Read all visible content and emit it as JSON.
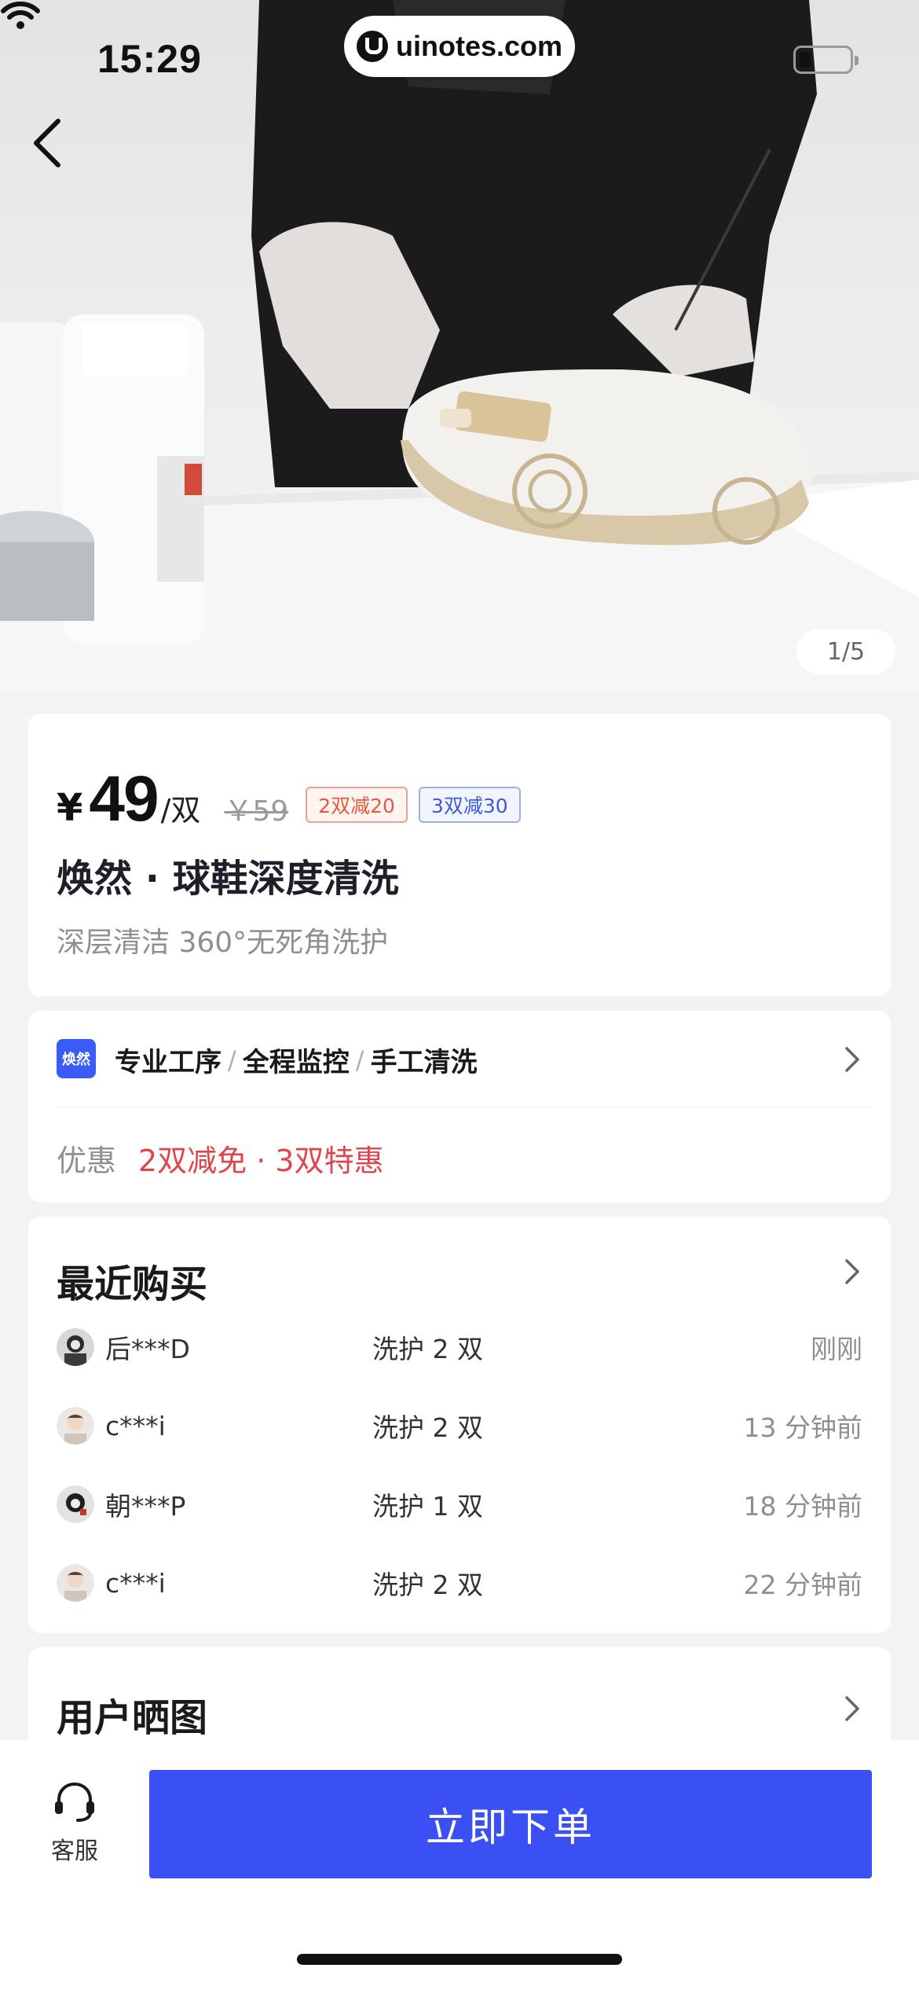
{
  "status_bar": {
    "time": "15:29",
    "url": "uinotes.com"
  },
  "hero": {
    "page_indicator": "1/5"
  },
  "product": {
    "currency": "¥",
    "price": "49",
    "unit": "/双",
    "original_price": "￥59",
    "tags": [
      "2双减20",
      "3双减30"
    ],
    "title": "焕然 · 球鞋深度清洗",
    "subtitle": "深层清洁 360°无死角洗护"
  },
  "features": {
    "badge": "焕然",
    "items": [
      "专业工序",
      "全程监控",
      "手工清洗"
    ],
    "separator": "/",
    "promo_label": "优惠",
    "promo_value": "2双减免 · 3双特惠"
  },
  "recent": {
    "title": "最近购买",
    "rows": [
      {
        "name": "后***D",
        "item": "洗护 2 双",
        "time": "刚刚"
      },
      {
        "name": "c***i",
        "item": "洗护 2 双",
        "time": "13 分钟前"
      },
      {
        "name": "朝***P",
        "item": "洗护 1 双",
        "time": "18 分钟前"
      },
      {
        "name": "c***i",
        "item": "洗护 2 双",
        "time": "22 分钟前"
      }
    ]
  },
  "photos": {
    "title": "用户晒图"
  },
  "bottom_bar": {
    "service_label": "客服",
    "order_label": "立即下单"
  },
  "colors": {
    "accent": "#3a50f2",
    "promo_red": "#e0454b",
    "tag_red": "#e55a3c",
    "tag_blue": "#3b5cd6"
  },
  "icons": [
    "back-icon",
    "wifi-icon",
    "battery-icon",
    "chevron-right-icon",
    "headset-icon"
  ]
}
